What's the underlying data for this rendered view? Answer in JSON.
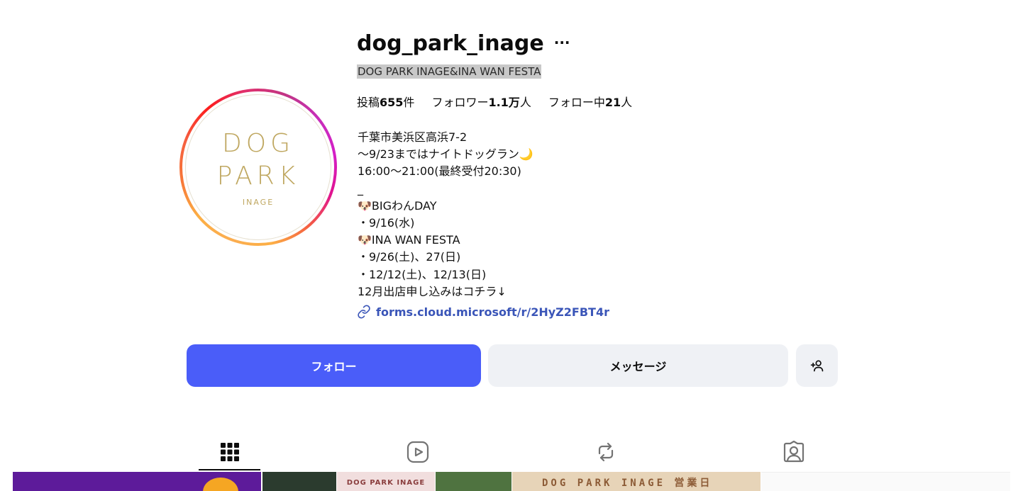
{
  "profile": {
    "username": "dog_park_inage",
    "more_label": "···",
    "full_name": "DOG PARK INAGE&INA WAN FESTA",
    "avatar": {
      "line1": "DOG",
      "line2": "PARK",
      "line3": "INAGE"
    },
    "stats": {
      "posts_prefix": "投稿",
      "posts_value": "655",
      "posts_suffix": "件",
      "followers_prefix": "フォロワー",
      "followers_value": "1.1万",
      "followers_suffix": "人",
      "following_prefix": "フォロー中",
      "following_value": "21",
      "following_suffix": "人"
    },
    "bio": [
      "千葉市美浜区高浜7-2",
      "〜9/23まではナイトドッグラン🌙",
      "16:00〜21:00(最終受付20:30)",
      "_",
      "🐶BIGわんDAY",
      "・9/16(水)",
      "🐶INA WAN FESTA",
      "・9/26(土)、27(日)",
      "・12/12(土)、12/13(日)",
      "12月出店申し込みはコチラ↓"
    ],
    "link": "forms.cloud.microsoft/r/2HyZ2FBT4r"
  },
  "actions": {
    "follow": "フォロー",
    "message": "メッセージ"
  },
  "tiles": {
    "pink_text": "DOG PARK INAGE",
    "beige_text": "DOG PARK INAGE 営業日"
  },
  "colors": {
    "follow_button": "#4a5df9",
    "link": "#3a55b8",
    "secondary_button": "#eff1f5"
  }
}
